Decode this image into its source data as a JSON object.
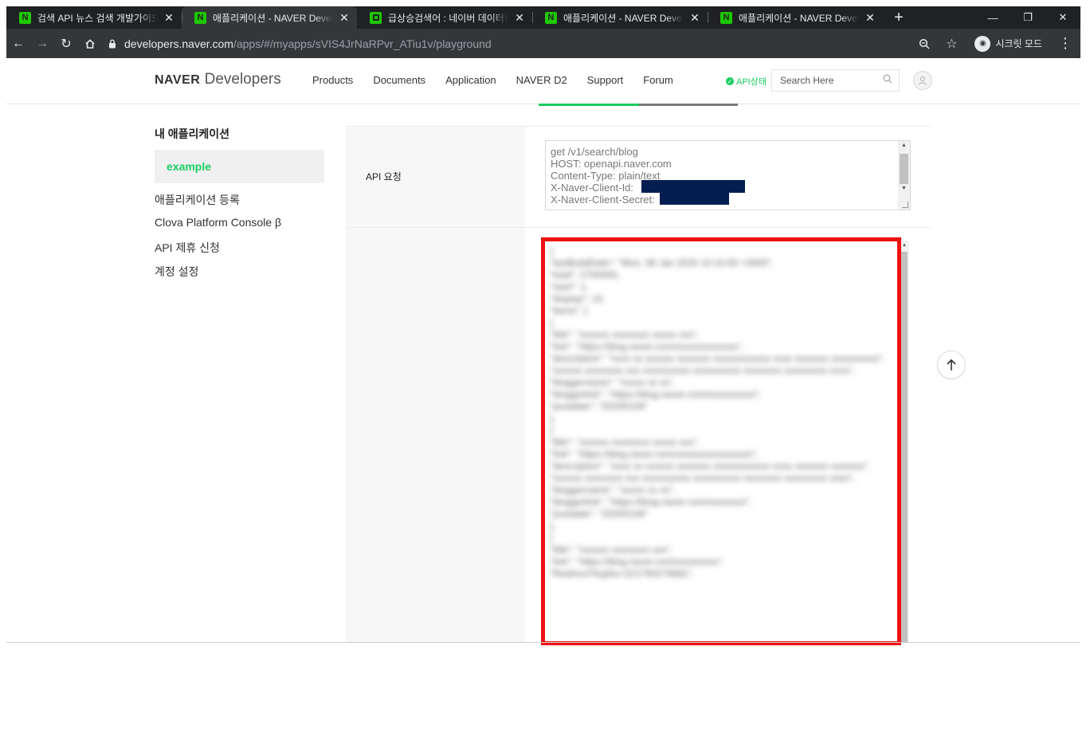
{
  "browser": {
    "tabs": [
      {
        "title": "검색 API 뉴스 검색 개발가이드",
        "favicon": "N",
        "active": false
      },
      {
        "title": "애플리케이션 - NAVER Developers",
        "favicon": "N",
        "active": true
      },
      {
        "title": "급상승검색어 : 네이버 데이터랩",
        "favicon": "datalab",
        "active": false
      },
      {
        "title": "애플리케이션 - NAVER Developers",
        "favicon": "N",
        "active": false
      },
      {
        "title": "애플리케이션 - NAVER Developers",
        "favicon": "N",
        "active": false
      }
    ],
    "url_host": "developers.naver.com",
    "url_path": "/apps/#/myapps/sVIS4JrNaRPvr_ATiu1v/playground",
    "incognito_label": "시크릿 모드"
  },
  "header": {
    "logo_brand": "NAVER",
    "logo_suffix": "Developers",
    "nav": [
      "Products",
      "Documents",
      "Application",
      "NAVER D2",
      "Support",
      "Forum"
    ],
    "api_status": "API상태",
    "search_placeholder": "Search Here"
  },
  "sidebar": {
    "title": "내 애플리케이션",
    "active_item": "example",
    "items": [
      "애플리케이션 등록",
      "Clova Platform Console β",
      "API 제휴 신청",
      "계정 설정"
    ]
  },
  "main": {
    "request_label": "API 요청",
    "request_text": "get /v1/search/blog\nHOST: openapi.naver.com\nContent-Type: plain/text\nX-Naver-Client-Id: \nX-Naver-Client-Secret: ",
    "response_text": "{\n\"lastBuildDate\": \"Mon, 06 Jan 2020 10:10:00 +0900\",\n\"total\": 2700000,\n\"start\": 1,\n\"display\": 10,\n\"items\": [\n{\n\"title\": \"xxxxxx xxxxxxxx xxxxx xxx\",\n\"link\": \"https://blog.naver.com/xxxxxxxxxxxxx\",\n\"description\": \"xxxx xx xxxxxx xxxxxxx xxxxxxxxxxxx xxxx xxxxxxx xxxxxxxxxx\",\n\"xxxxxx xxxxxxxx xxx xxxxxxxxxx xxxxxxxxxx xxxxxxxx xxxxxxxxx xxxx\",\n\"bloggername\": \"xxxxx xx xx\",\n\"bloggerlink\": \"https://blog.naver.com/xxxxxxxxxx\",\n\"postdate\": \"20200106\"\n},\n{\n\"title\": \"xxxxxx xxxxxxxx xxxxx xxx\",\n\"link\": \"https://blog.naver.com/xxxxxxxxxxxxxxxx\",\n\"description\": \"xxxx xx xxxxxx xxxxxxx xxxxxxxxxxxx xxxx xxxxxxx xxxxxxx\",\n\"xxxxxx xxxxxxxx xxx xxxxxxxxxx xxxxxxxxxx xxxxxxxx xxxxxxxxx xxxx\",\n\"bloggername\": \"xxxxx xx xx\",\n\"bloggerlink\": \"https://blog.naver.com/xxxxxxxx\",\n\"postdate\": \"20200106\"\n},\n{\n\"title\": \"xxxxxx xxxxxxxx xxx\",\n\"link\": \"https://blog.naver.com/xxxxxxxxx\",\n\"Redirect?logNo=221760276681\","
  },
  "colors": {
    "brand_green": "#19ce60",
    "highlight_red": "#ee1111",
    "redaction_navy": "#041e50"
  }
}
